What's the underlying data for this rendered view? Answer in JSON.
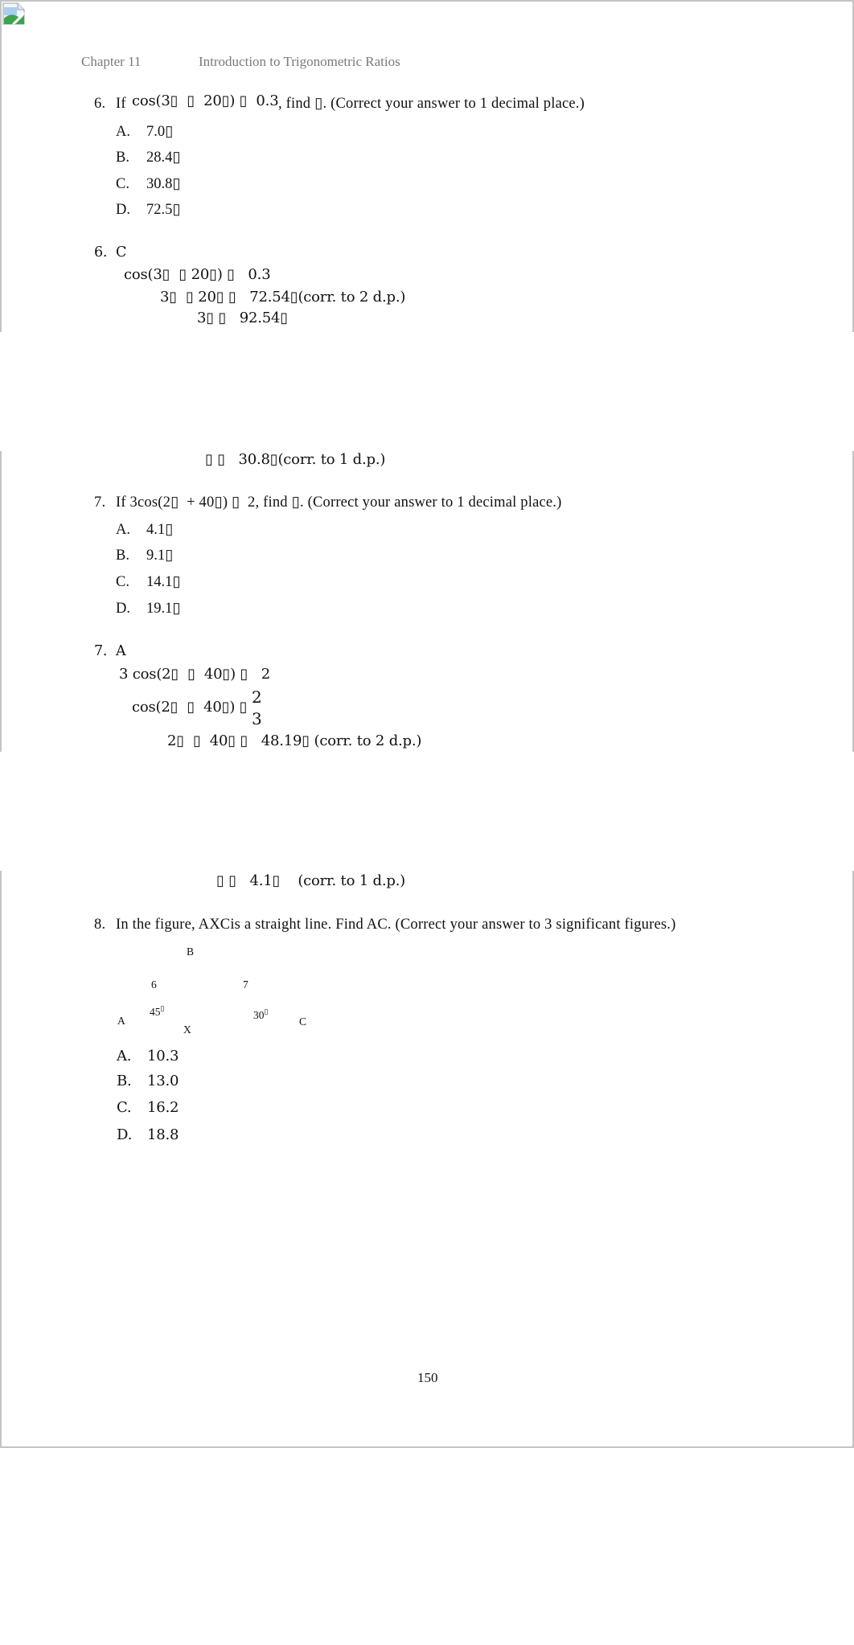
{
  "header": {
    "chapter": "Chapter 11",
    "title": "Introduction to Trigonometric Ratios"
  },
  "q6": {
    "number": "6.",
    "prefix": "If",
    "expr": "cos(3▯  ▯  20▯) ▯  0.3",
    "suffix": ", find ▯. (Correct your answer to 1 decimal place.)",
    "options": [
      {
        "label": "A.",
        "value": "7.0▯"
      },
      {
        "label": "B.",
        "value": "28.4▯"
      },
      {
        "label": "C.",
        "value": "30.8▯"
      },
      {
        "label": "D.",
        "value": "72.5▯"
      }
    ]
  },
  "a6": {
    "header": "6.  C",
    "lines": [
      "cos(3▯  ▯ 20▯) ▯   0.3",
      "3▯  ▯ 20▯ ▯   72.54▯(corr. to 2 d.p.)",
      "3▯ ▯   92.54▯",
      "▯ ▯   30.8▯(corr. to 1 d.p.)"
    ]
  },
  "q7": {
    "number": "7.",
    "text": "If 3cos(2▯  + 40▯) ▯  2, find ▯. (Correct your answer to 1 decimal place.)",
    "options": [
      {
        "label": "A.",
        "value": "4.1▯"
      },
      {
        "label": "B.",
        "value": "9.1▯"
      },
      {
        "label": "C.",
        "value": "14.1▯"
      },
      {
        "label": "D.",
        "value": "19.1▯"
      }
    ]
  },
  "a7": {
    "header": "7.  A",
    "line1": "3 cos(2▯  ▯  40▯) ▯   2",
    "line2": "cos(2▯  ▯  40▯) ▯",
    "frac_num": "2",
    "frac_den": "3",
    "line3": "2▯  ▯  40▯ ▯   48.19▯ (corr. to 2 d.p.)",
    "line4": "▯ ▯   4.1▯    (corr. to 1 d.p.)"
  },
  "q8": {
    "number": "8.",
    "text": "In the figure, AXCis a straight line. Find AC. (Correct your answer to 3 significant figures.)",
    "figure": {
      "B": "B",
      "side_AB": "6",
      "side_BC": "7",
      "angle_A": "45",
      "angle_C": "30",
      "degree_glyph": "▯",
      "A": "A",
      "X": "X",
      "C": "C"
    },
    "options": [
      {
        "label": "A.",
        "value": "10.3"
      },
      {
        "label": "B.",
        "value": "13.0"
      },
      {
        "label": "C.",
        "value": "16.2"
      },
      {
        "label": "D.",
        "value": "18.8"
      }
    ]
  },
  "footer": {
    "page_number": "150"
  },
  "colors": {
    "border": "#c4c4c4",
    "header_text": "#7a7a7a",
    "body_text": "#111111"
  }
}
